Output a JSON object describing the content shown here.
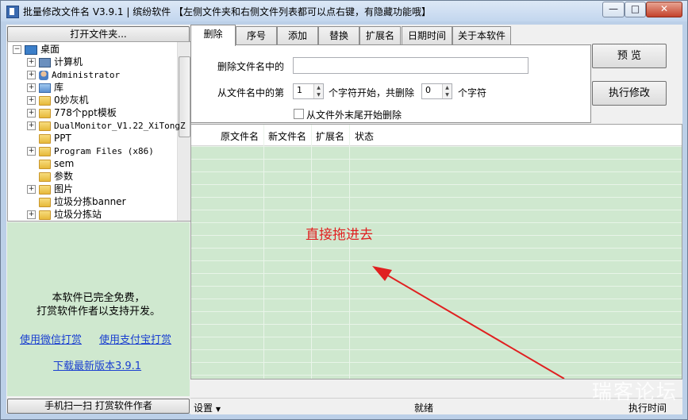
{
  "window": {
    "title": "批量修改文件名 V3.9.1 | 缤纷软件  【左侧文件夹和右侧文件列表都可以点右键，有隐藏功能哦】",
    "min_glyph": "—",
    "max_glyph": "□",
    "close_glyph": "✕"
  },
  "left": {
    "open_folder_label": "打开文件夹...",
    "tree": [
      {
        "label": "桌面",
        "icon": "desktop-icon",
        "expander": "−",
        "indent": 0
      },
      {
        "label": "计算机",
        "icon": "computer-icon",
        "expander": "+",
        "indent": 1
      },
      {
        "label": "Administrator",
        "icon": "user-icon",
        "expander": "+",
        "indent": 1,
        "mono": true
      },
      {
        "label": "库",
        "icon": "library-icon",
        "expander": "+",
        "indent": 1
      },
      {
        "label": "0妙灰机",
        "icon": "folder-icon",
        "expander": "+",
        "indent": 1
      },
      {
        "label": "778个ppt模板",
        "icon": "folder-icon",
        "expander": "+",
        "indent": 1
      },
      {
        "label": "DualMonitor_V1.22_XiTongZ",
        "icon": "folder-icon",
        "expander": "+",
        "indent": 1,
        "mono": true
      },
      {
        "label": "PPT",
        "icon": "folder-icon",
        "expander": "",
        "indent": 1
      },
      {
        "label": "Program Files (x86)",
        "icon": "folder-icon",
        "expander": "+",
        "indent": 1,
        "mono": true
      },
      {
        "label": "sem",
        "icon": "folder-icon",
        "expander": "",
        "indent": 1
      },
      {
        "label": "参数",
        "icon": "folder-icon",
        "expander": "",
        "indent": 1
      },
      {
        "label": "图片",
        "icon": "folder-icon",
        "expander": "+",
        "indent": 1
      },
      {
        "label": "垃圾分拣banner",
        "icon": "folder-icon",
        "expander": "",
        "indent": 1
      },
      {
        "label": "垃圾分拣站",
        "icon": "folder-icon",
        "expander": "+",
        "indent": 1
      }
    ],
    "free_line1": "本软件已完全免费，",
    "free_line2": "打赏软件作者以支持开发。",
    "wechat_link": "使用微信打赏",
    "alipay_link": "使用支付宝打赏",
    "download_link": "下载最新版本3.9.1",
    "scan_button": "手机扫一扫 打赏软件作者"
  },
  "tabs": [
    "删除",
    "序号",
    "添加",
    "替换",
    "扩展名",
    "日期时间",
    "关于本软件"
  ],
  "delete_panel": {
    "label_name_contains": "删除文件名中的",
    "name_value": "",
    "label_from": "从文件名中的第",
    "start_value": "1",
    "label_mid": "个字符开始，共删除",
    "count_value": "0",
    "label_chars": "个字符",
    "checkbox_label": "从文件外末尾开始删除"
  },
  "actions": {
    "preview": "预    览",
    "execute": "执行修改"
  },
  "grid": {
    "columns": [
      "原文件名",
      "新文件名",
      "扩展名",
      "状态"
    ],
    "rows": [],
    "drag_hint": "直接拖进去"
  },
  "status": {
    "settings": "设置",
    "state": "就绪",
    "exec_time": "执行时间"
  },
  "watermark": "瑞客论坛",
  "colors": {
    "grid_bg": "#cfe8cf",
    "hint_red": "#e02020",
    "link_blue": "#1a3fd0"
  }
}
